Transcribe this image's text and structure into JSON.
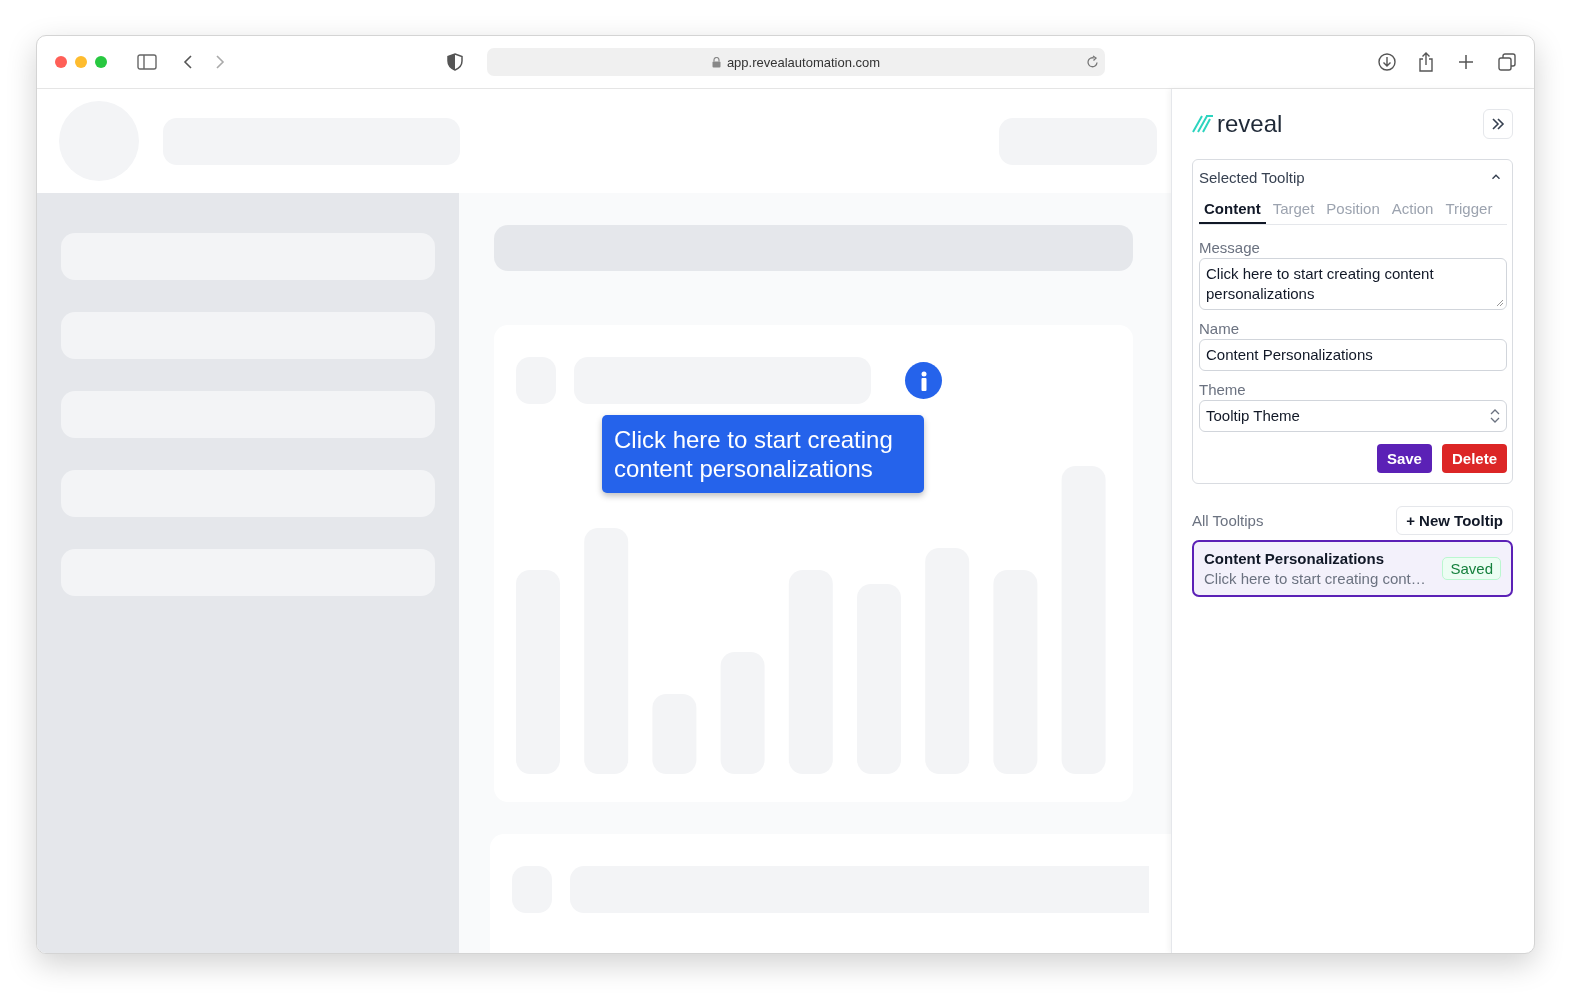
{
  "browser": {
    "url": "app.revealautomation.com"
  },
  "page": {
    "tooltip_text": "Click here to start creating content personalizations"
  },
  "panel": {
    "logo": "reveal",
    "section_title": "Selected Tooltip",
    "expanded": true,
    "tabs": [
      {
        "label": "Content",
        "selected": true
      },
      {
        "label": "Target",
        "selected": false
      },
      {
        "label": "Position",
        "selected": false
      },
      {
        "label": "Action",
        "selected": false
      },
      {
        "label": "Trigger",
        "selected": false
      }
    ],
    "fields": [
      {
        "kind": "textarea",
        "label": "Message",
        "value": "Click here to start creating content personalizations"
      },
      {
        "kind": "text",
        "label": "Name",
        "value": "Content Personalizations"
      },
      {
        "kind": "select",
        "label": "Theme",
        "value": "Tooltip Theme"
      }
    ],
    "buttons": [
      {
        "kind": "primary",
        "label": "Save"
      },
      {
        "kind": "danger",
        "label": "Delete"
      }
    ],
    "list_title": "All Tooltips",
    "new_button": "+ New Tooltip",
    "tooltips": [
      {
        "name": "Content Personalizations",
        "preview": "Click here to start creating cont…",
        "status": "Saved",
        "selected": true
      }
    ]
  }
}
